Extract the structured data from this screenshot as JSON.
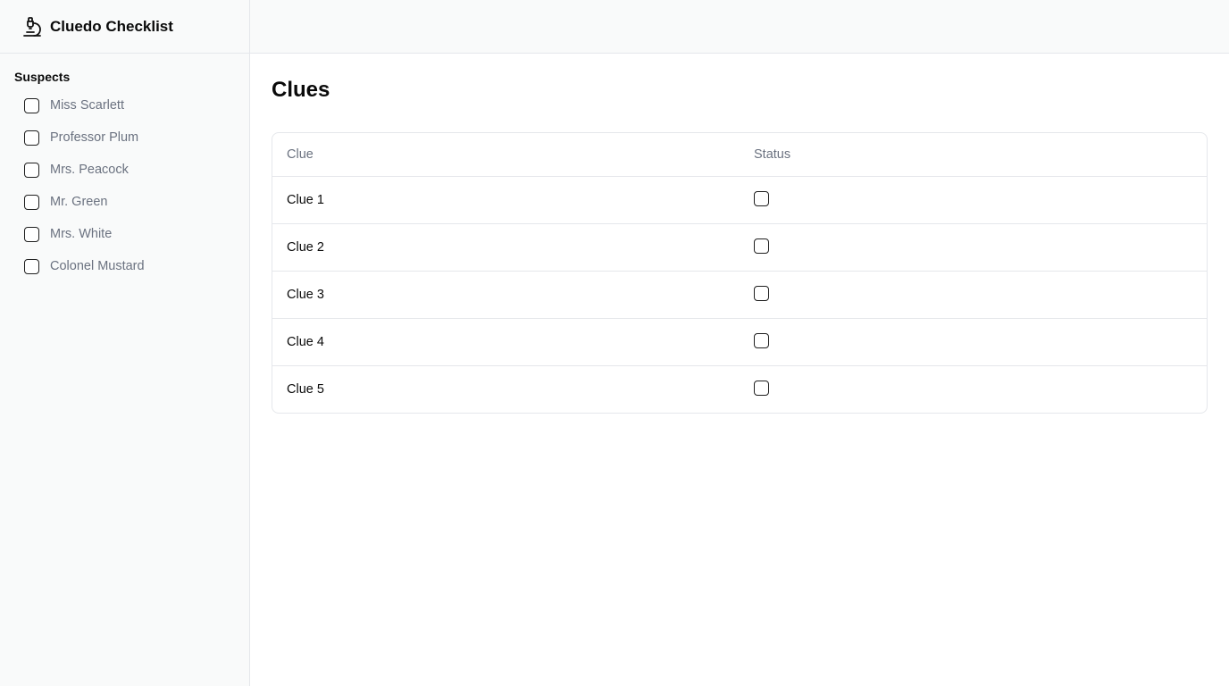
{
  "app": {
    "title": "Cluedo Checklist",
    "icon": "microscope-icon"
  },
  "sidebar": {
    "section_title": "Suspects",
    "items": [
      {
        "label": "Miss Scarlett",
        "checked": false
      },
      {
        "label": "Professor Plum",
        "checked": false
      },
      {
        "label": "Mrs. Peacock",
        "checked": false
      },
      {
        "label": "Mr. Green",
        "checked": false
      },
      {
        "label": "Mrs. White",
        "checked": false
      },
      {
        "label": "Colonel Mustard",
        "checked": false
      }
    ]
  },
  "main": {
    "title": "Clues",
    "table": {
      "headers": [
        "Clue",
        "Status"
      ],
      "rows": [
        {
          "clue": "Clue 1",
          "checked": false
        },
        {
          "clue": "Clue 2",
          "checked": false
        },
        {
          "clue": "Clue 3",
          "checked": false
        },
        {
          "clue": "Clue 4",
          "checked": false
        },
        {
          "clue": "Clue 5",
          "checked": false
        }
      ]
    }
  },
  "colors": {
    "sidebar_bg": "#f9fafa",
    "border": "#e5e7eb",
    "muted_text": "#6b7280",
    "text": "#0a0a0a"
  }
}
